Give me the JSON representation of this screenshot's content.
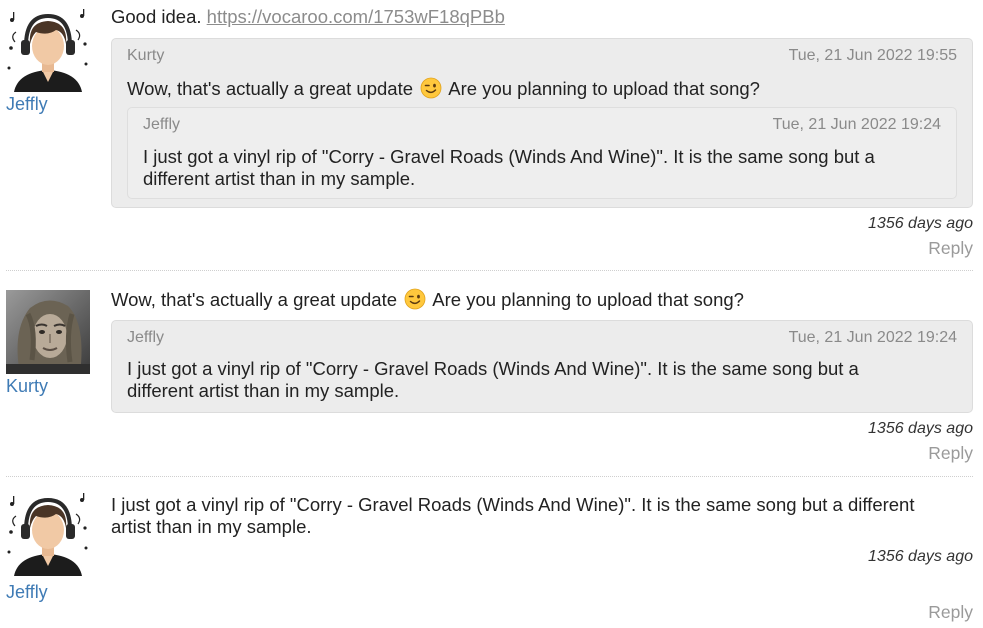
{
  "comments": [
    {
      "user": "Jeffly",
      "text_prefix": "Good idea. ",
      "link": "https://vocaroo.com/1753wF18qPBb",
      "ago": "1356 days ago",
      "reply": "Reply",
      "quote": {
        "author": "Kurty",
        "date": "Tue, 21 Jun 2022 19:55",
        "text_before_emoji": "Wow, that's actually a great update",
        "text_after_emoji": "Are you planning to upload that song?",
        "quote": {
          "author": "Jeffly",
          "date": "Tue, 21 Jun 2022 19:24",
          "line1": "I just got a vinyl rip of \"Corry - Gravel Roads (Winds And Wine)\". It is the same song but a",
          "line2": "different artist than in my sample."
        }
      }
    },
    {
      "user": "Kurty",
      "text_before_emoji": "Wow, that's actually a great update",
      "text_after_emoji": "Are you planning to upload that song?",
      "ago": "1356 days ago",
      "reply": "Reply",
      "quote": {
        "author": "Jeffly",
        "date": "Tue, 21 Jun 2022 19:24",
        "line1": "I just got a vinyl rip of \"Corry - Gravel Roads (Winds And Wine)\". It is the same song but a",
        "line2": "different artist than in my sample."
      }
    },
    {
      "user": "Jeffly",
      "line1": "I just got a vinyl rip of \"Corry - Gravel Roads (Winds And Wine)\". It is the same song but a different",
      "line2": "artist than in my sample.",
      "ago": "1356 days ago",
      "reply": "Reply"
    }
  ],
  "colors": {
    "username": "#3f7bb5",
    "quote_bg": "#ececec",
    "link": "#8c8c8c",
    "reply": "#9a9a9a"
  },
  "icons": {
    "emoji": "winking-face-icon",
    "avatar_jeffly": "headphones-avatar",
    "avatar_kurty": "photo-avatar"
  }
}
